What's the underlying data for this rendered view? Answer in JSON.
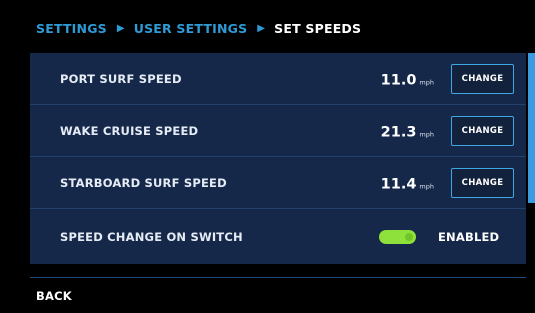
{
  "breadcrumb": {
    "items": [
      "SETTINGS",
      "USER SETTINGS",
      "SET SPEEDS"
    ],
    "separator": "▶"
  },
  "speeds": [
    {
      "label": "PORT SURF SPEED",
      "value": "11.0",
      "unit": "mph",
      "button": "CHANGE"
    },
    {
      "label": "WAKE CRUISE SPEED",
      "value": "21.3",
      "unit": "mph",
      "button": "CHANGE"
    },
    {
      "label": "STARBOARD SURF SPEED",
      "value": "11.4",
      "unit": "mph",
      "button": "CHANGE"
    }
  ],
  "speed_change": {
    "label": "SPEED CHANGE ON SWITCH",
    "state": "ENABLED",
    "enabled": true
  },
  "back_label": "BACK",
  "colors": {
    "background": "#000000",
    "panel": "#15284a",
    "accent_blue": "#2e9bd6",
    "button_border": "#3fa7e2",
    "toggle_on": "#8ee03a",
    "scrollbar": "#3b9be0",
    "text": "#ffffff"
  }
}
